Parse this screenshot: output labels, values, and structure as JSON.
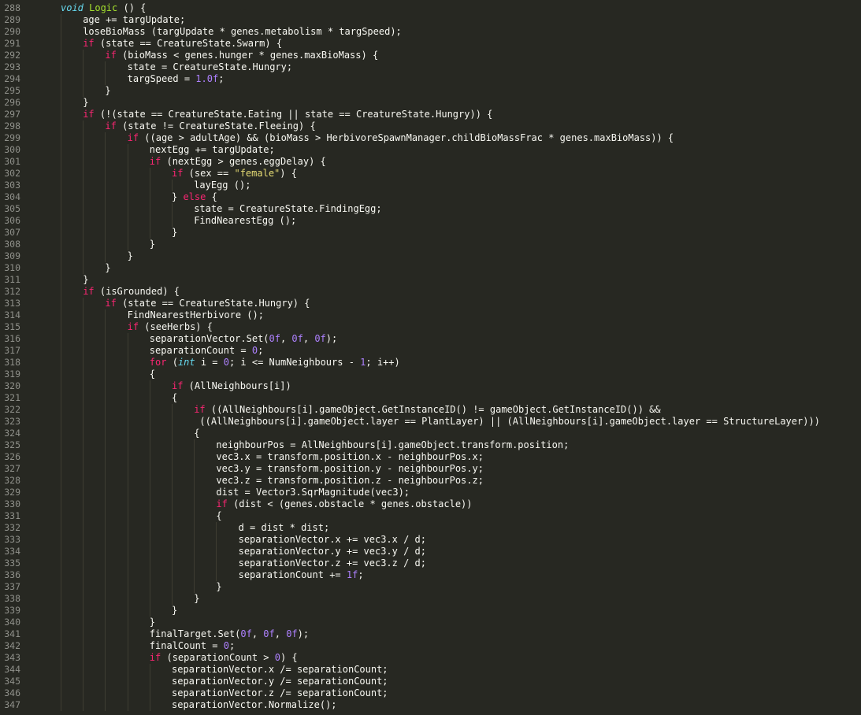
{
  "editor": {
    "theme_colors": {
      "background": "#272822",
      "foreground": "#f8f8f2",
      "keyword": "#f92672",
      "type": "#66d9ef",
      "function": "#a6e22e",
      "number": "#ae81ff",
      "string": "#e6db74",
      "gutter": "#8f908a",
      "indent_guide": "#3e3d32"
    },
    "lines": [
      {
        "n": "288",
        "i": 0,
        "t": [
          [
            "void ",
            "ty"
          ],
          [
            "Logic",
            "fn"
          ],
          [
            " () {",
            "pl"
          ]
        ]
      },
      {
        "n": "289",
        "i": 1,
        "t": [
          [
            "age += targUpdate;",
            "pl"
          ]
        ]
      },
      {
        "n": "290",
        "i": 1,
        "t": [
          [
            "loseBioMass (targUpdate * genes.metabolism * targSpeed);",
            "pl"
          ]
        ]
      },
      {
        "n": "291",
        "i": 1,
        "t": [
          [
            "if",
            "kw"
          ],
          [
            " (state == CreatureState.Swarm) {",
            "pl"
          ]
        ]
      },
      {
        "n": "292",
        "i": 2,
        "t": [
          [
            "if",
            "kw"
          ],
          [
            " (bioMass < genes.hunger * genes.maxBioMass) {",
            "pl"
          ]
        ]
      },
      {
        "n": "293",
        "i": 3,
        "t": [
          [
            "state = CreatureState.Hungry;",
            "pl"
          ]
        ]
      },
      {
        "n": "294",
        "i": 3,
        "t": [
          [
            "targSpeed = ",
            "pl"
          ],
          [
            "1.0f",
            "nm"
          ],
          [
            ";",
            "pl"
          ]
        ]
      },
      {
        "n": "295",
        "i": 2,
        "t": [
          [
            "}",
            "pl"
          ]
        ]
      },
      {
        "n": "296",
        "i": 1,
        "t": [
          [
            "}",
            "pl"
          ]
        ]
      },
      {
        "n": "297",
        "i": 1,
        "t": [
          [
            "if",
            "kw"
          ],
          [
            " (!(state == CreatureState.Eating || state == CreatureState.Hungry)) {",
            "pl"
          ]
        ]
      },
      {
        "n": "298",
        "i": 2,
        "t": [
          [
            "if",
            "kw"
          ],
          [
            " (state != CreatureState.Fleeing) {",
            "pl"
          ]
        ]
      },
      {
        "n": "299",
        "i": 3,
        "t": [
          [
            "if",
            "kw"
          ],
          [
            " ((age > adultAge) && (bioMass > HerbivoreSpawnManager.childBioMassFrac * genes.maxBioMass)) {",
            "pl"
          ]
        ]
      },
      {
        "n": "300",
        "i": 4,
        "t": [
          [
            "nextEgg += targUpdate;",
            "pl"
          ]
        ]
      },
      {
        "n": "301",
        "i": 4,
        "t": [
          [
            "if",
            "kw"
          ],
          [
            " (nextEgg > genes.eggDelay) {",
            "pl"
          ]
        ]
      },
      {
        "n": "302",
        "i": 5,
        "t": [
          [
            "if",
            "kw"
          ],
          [
            " (sex == ",
            "pl"
          ],
          [
            "\"female\"",
            "st"
          ],
          [
            ") {",
            "pl"
          ]
        ]
      },
      {
        "n": "303",
        "i": 6,
        "t": [
          [
            "layEgg ();",
            "pl"
          ]
        ]
      },
      {
        "n": "304",
        "i": 5,
        "t": [
          [
            "} ",
            "pl"
          ],
          [
            "else",
            "kw"
          ],
          [
            " {",
            "pl"
          ]
        ]
      },
      {
        "n": "305",
        "i": 6,
        "t": [
          [
            "state = CreatureState.FindingEgg;",
            "pl"
          ]
        ]
      },
      {
        "n": "306",
        "i": 6,
        "t": [
          [
            "FindNearestEgg ();",
            "pl"
          ]
        ]
      },
      {
        "n": "307",
        "i": 5,
        "t": [
          [
            "}",
            "pl"
          ]
        ]
      },
      {
        "n": "308",
        "i": 4,
        "t": [
          [
            "}",
            "pl"
          ]
        ]
      },
      {
        "n": "309",
        "i": 3,
        "t": [
          [
            "}",
            "pl"
          ]
        ]
      },
      {
        "n": "310",
        "i": 2,
        "t": [
          [
            "}",
            "pl"
          ]
        ]
      },
      {
        "n": "311",
        "i": 1,
        "t": [
          [
            "}",
            "pl"
          ]
        ]
      },
      {
        "n": "312",
        "i": 1,
        "t": [
          [
            "if",
            "kw"
          ],
          [
            " (isGrounded) {",
            "pl"
          ]
        ]
      },
      {
        "n": "313",
        "i": 2,
        "t": [
          [
            "if",
            "kw"
          ],
          [
            " (state == CreatureState.Hungry) {",
            "pl"
          ]
        ]
      },
      {
        "n": "314",
        "i": 3,
        "t": [
          [
            "FindNearestHerbivore ();",
            "pl"
          ]
        ]
      },
      {
        "n": "315",
        "i": 3,
        "t": [
          [
            "if",
            "kw"
          ],
          [
            " (seeHerbs) {",
            "pl"
          ]
        ]
      },
      {
        "n": "316",
        "i": 4,
        "t": [
          [
            "separationVector.Set(",
            "pl"
          ],
          [
            "0f",
            "nm"
          ],
          [
            ", ",
            "pl"
          ],
          [
            "0f",
            "nm"
          ],
          [
            ", ",
            "pl"
          ],
          [
            "0f",
            "nm"
          ],
          [
            ");",
            "pl"
          ]
        ]
      },
      {
        "n": "317",
        "i": 4,
        "t": [
          [
            "separationCount = ",
            "pl"
          ],
          [
            "0",
            "nm"
          ],
          [
            ";",
            "pl"
          ]
        ]
      },
      {
        "n": "318",
        "i": 4,
        "t": [
          [
            "for",
            "kw"
          ],
          [
            " (",
            "pl"
          ],
          [
            "int",
            "ty"
          ],
          [
            " i = ",
            "pl"
          ],
          [
            "0",
            "nm"
          ],
          [
            "; i <= NumNeighbours - ",
            "pl"
          ],
          [
            "1",
            "nm"
          ],
          [
            "; i++)",
            "pl"
          ]
        ]
      },
      {
        "n": "319",
        "i": 4,
        "t": [
          [
            "{",
            "pl"
          ]
        ]
      },
      {
        "n": "320",
        "i": 5,
        "t": [
          [
            "if",
            "kw"
          ],
          [
            " (AllNeighbours[i])",
            "pl"
          ]
        ]
      },
      {
        "n": "321",
        "i": 5,
        "t": [
          [
            "{",
            "pl"
          ]
        ]
      },
      {
        "n": "322",
        "i": 6,
        "t": [
          [
            "if",
            "kw"
          ],
          [
            " ((AllNeighbours[i].gameObject.GetInstanceID() != gameObject.GetInstanceID()) &&",
            "pl"
          ]
        ]
      },
      {
        "n": "323",
        "i": 6,
        "t": [
          [
            " ((AllNeighbours[i].gameObject.layer == PlantLayer) || (AllNeighbours[i].gameObject.layer == StructureLayer)))",
            "pl"
          ]
        ]
      },
      {
        "n": "324",
        "i": 6,
        "t": [
          [
            "{",
            "pl"
          ]
        ]
      },
      {
        "n": "325",
        "i": 7,
        "t": [
          [
            "neighbourPos = AllNeighbours[i].gameObject.transform.position;",
            "pl"
          ]
        ]
      },
      {
        "n": "326",
        "i": 7,
        "t": [
          [
            "vec3.x = transform.position.x - neighbourPos.x;",
            "pl"
          ]
        ]
      },
      {
        "n": "327",
        "i": 7,
        "t": [
          [
            "vec3.y = transform.position.y - neighbourPos.y;",
            "pl"
          ]
        ]
      },
      {
        "n": "328",
        "i": 7,
        "t": [
          [
            "vec3.z = transform.position.z - neighbourPos.z;",
            "pl"
          ]
        ]
      },
      {
        "n": "329",
        "i": 7,
        "t": [
          [
            "dist = Vector3.SqrMagnitude(vec3);",
            "pl"
          ]
        ]
      },
      {
        "n": "330",
        "i": 7,
        "t": [
          [
            "if",
            "kw"
          ],
          [
            " (dist < (genes.obstacle * genes.obstacle))",
            "pl"
          ]
        ]
      },
      {
        "n": "331",
        "i": 7,
        "t": [
          [
            "{",
            "pl"
          ]
        ]
      },
      {
        "n": "332",
        "i": 8,
        "t": [
          [
            "d = dist * dist;",
            "pl"
          ]
        ]
      },
      {
        "n": "333",
        "i": 8,
        "t": [
          [
            "separationVector.x += vec3.x / d;",
            "pl"
          ]
        ]
      },
      {
        "n": "334",
        "i": 8,
        "t": [
          [
            "separationVector.y += vec3.y / d;",
            "pl"
          ]
        ]
      },
      {
        "n": "335",
        "i": 8,
        "t": [
          [
            "separationVector.z += vec3.z / d;",
            "pl"
          ]
        ]
      },
      {
        "n": "336",
        "i": 8,
        "t": [
          [
            "separationCount += ",
            "pl"
          ],
          [
            "1f",
            "nm"
          ],
          [
            ";",
            "pl"
          ]
        ]
      },
      {
        "n": "337",
        "i": 7,
        "t": [
          [
            "}",
            "pl"
          ]
        ]
      },
      {
        "n": "338",
        "i": 6,
        "t": [
          [
            "}",
            "pl"
          ]
        ]
      },
      {
        "n": "339",
        "i": 5,
        "t": [
          [
            "}",
            "pl"
          ]
        ]
      },
      {
        "n": "340",
        "i": 4,
        "t": [
          [
            "}",
            "pl"
          ]
        ]
      },
      {
        "n": "341",
        "i": 4,
        "t": [
          [
            "finalTarget.Set(",
            "pl"
          ],
          [
            "0f",
            "nm"
          ],
          [
            ", ",
            "pl"
          ],
          [
            "0f",
            "nm"
          ],
          [
            ", ",
            "pl"
          ],
          [
            "0f",
            "nm"
          ],
          [
            ");",
            "pl"
          ]
        ]
      },
      {
        "n": "342",
        "i": 4,
        "t": [
          [
            "finalCount = ",
            "pl"
          ],
          [
            "0",
            "nm"
          ],
          [
            ";",
            "pl"
          ]
        ]
      },
      {
        "n": "343",
        "i": 4,
        "t": [
          [
            "if",
            "kw"
          ],
          [
            " (separationCount > ",
            "pl"
          ],
          [
            "0",
            "nm"
          ],
          [
            ") {",
            "pl"
          ]
        ]
      },
      {
        "n": "344",
        "i": 5,
        "t": [
          [
            "separationVector.x /= separationCount;",
            "pl"
          ]
        ]
      },
      {
        "n": "345",
        "i": 5,
        "t": [
          [
            "separationVector.y /= separationCount;",
            "pl"
          ]
        ]
      },
      {
        "n": "346",
        "i": 5,
        "t": [
          [
            "separationVector.z /= separationCount;",
            "pl"
          ]
        ]
      },
      {
        "n": "347",
        "i": 5,
        "t": [
          [
            "separationVector.Normalize();",
            "pl"
          ]
        ]
      }
    ]
  }
}
